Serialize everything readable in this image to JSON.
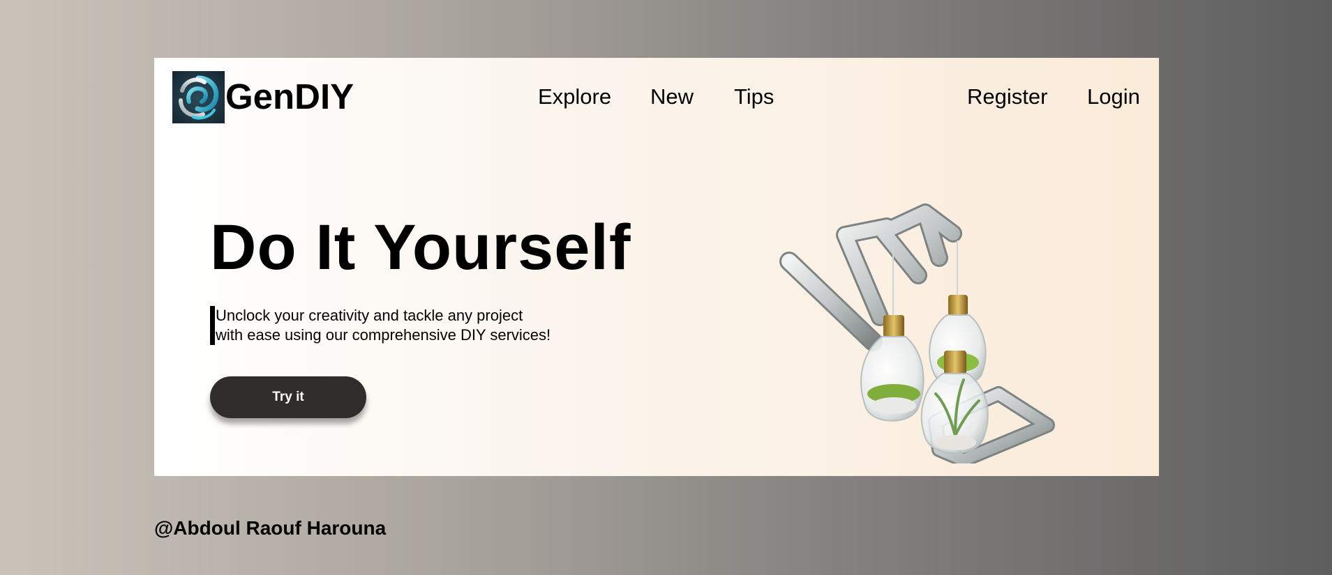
{
  "brand": {
    "name": "GenDIY",
    "logo_icon": "swirl-logo-icon"
  },
  "nav": {
    "items": [
      {
        "label": "Explore"
      },
      {
        "label": "New"
      },
      {
        "label": "Tips"
      }
    ],
    "auth": {
      "register": "Register",
      "login": "Login"
    }
  },
  "hero": {
    "title": "Do It Yourself",
    "description_line1": "Unclock your creativity and tackle any project",
    "description_line2": "with ease using our comprehensive DIY services!",
    "cta_label": "Try it",
    "illustration": "hanging-lightbulb-terrariums-image"
  },
  "footer": {
    "credit": "@Abdoul Raouf Harouna"
  },
  "colors": {
    "card_start": "#ffffff",
    "card_end": "#fbebd9",
    "cta_bg": "#2f2d2b",
    "logo_accent": "#35b6d6"
  }
}
